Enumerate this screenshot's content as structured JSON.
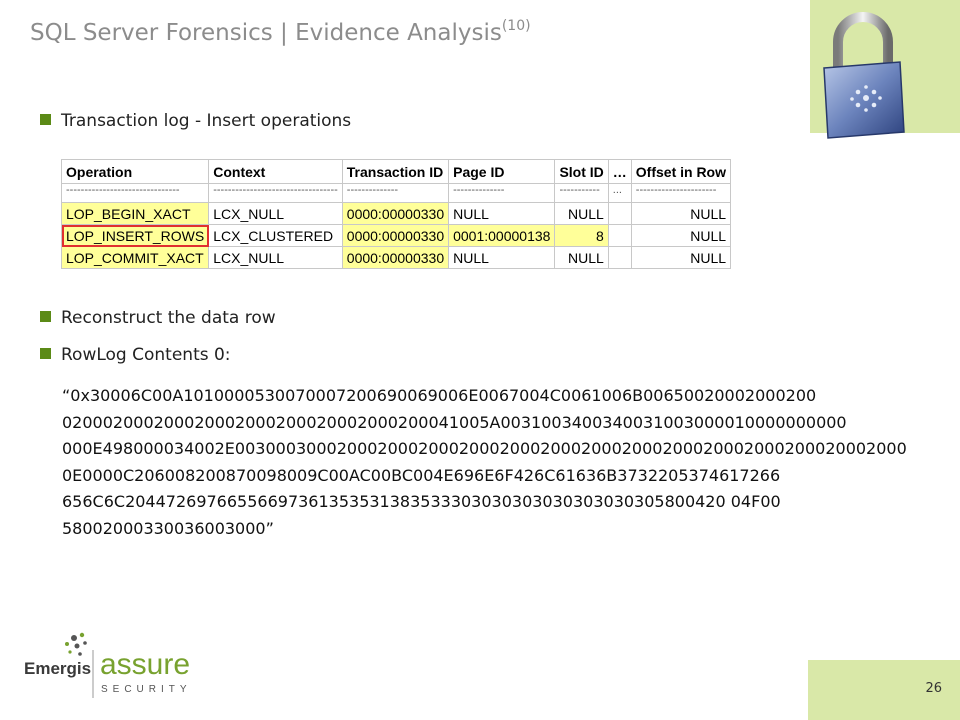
{
  "slide": {
    "title": "SQL Server Forensics | Evidence Analysis",
    "title_sup": "(10)",
    "page_number": "26"
  },
  "bullets": {
    "b1": "Transaction log - Insert operations",
    "b2": "Reconstruct the data row",
    "b3": "RowLog Contents 0:"
  },
  "table": {
    "headers": [
      "Operation",
      "Context",
      "Transaction ID",
      "Page ID",
      "Slot ID",
      "…",
      "Offset in Row"
    ],
    "dashes": [
      "-------------------------------",
      "----------------------------------",
      "--------------",
      "--------------",
      "-----------",
      "...",
      "----------------------"
    ],
    "rows": [
      {
        "op": "LOP_BEGIN_XACT",
        "ctx": "LCX_NULL",
        "tid": "0000:00000330",
        "pid": "NULL",
        "slot": "NULL",
        "dots": "",
        "off": "NULL"
      },
      {
        "op": "LOP_INSERT_ROWS",
        "ctx": "LCX_CLUSTERED",
        "tid": "0000:00000330",
        "pid": "0001:00000138",
        "slot": "8",
        "dots": "",
        "off": "NULL"
      },
      {
        "op": "LOP_COMMIT_XACT",
        "ctx": "LCX_NULL",
        "tid": "0000:00000330",
        "pid": "NULL",
        "slot": "NULL",
        "dots": "",
        "off": "NULL"
      }
    ]
  },
  "rowlog": {
    "lines": [
      "“0x30006C00A1010000530070007200690069006E0067004C0061006B00650020002000200",
      "020002000200020002000200020002000200041005A0031003400340031003000010000000000",
      "000E498000034002E003000300020002000200020002000200020002000200020002000200020002000",
      "0E0000C206008200870098009C00AC00BC004E696E6F426C61636B3732205374617266",
      "656C6C20447269766556697361353531383533303030303030303030305800420 04F00",
      "58002000330036003000”"
    ]
  },
  "logo": {
    "brand": "Emergis",
    "product": "assure",
    "tagline": "SECURITY"
  },
  "colors": {
    "accent_green": "#d9e8a8",
    "bullet_green": "#5b8a16",
    "highlight_yellow": "#ffff99",
    "highlight_red": "#e03030"
  }
}
